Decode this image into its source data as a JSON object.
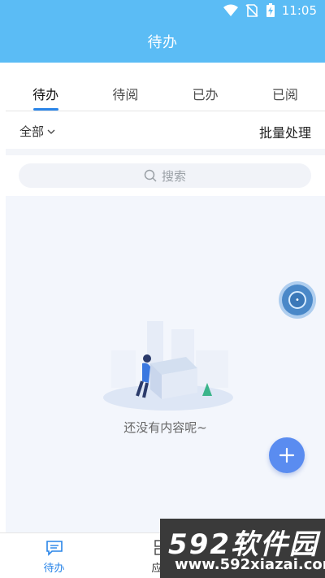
{
  "status": {
    "time": "11:05"
  },
  "header": {
    "title": "待办"
  },
  "tabs": [
    {
      "label": "待办",
      "active": true
    },
    {
      "label": "待阅",
      "active": false
    },
    {
      "label": "已办",
      "active": false
    },
    {
      "label": "已阅",
      "active": false
    }
  ],
  "filter": {
    "selected": "全部",
    "batch_label": "批量处理"
  },
  "search": {
    "placeholder": "搜索"
  },
  "empty_state": {
    "text": "还没有内容呢~"
  },
  "bottom_nav": [
    {
      "label": "待办",
      "icon": "message-icon",
      "active": true
    },
    {
      "label": "应用",
      "icon": "apps-grid-icon",
      "active": false
    },
    {
      "label": "",
      "icon": "profile-icon",
      "active": false
    }
  ],
  "watermark": {
    "brand": "592软件园",
    "url": "www.592xiazai.com"
  },
  "colors": {
    "header": "#5bbcf5",
    "accent": "#2a85e8",
    "fab": "#5a8cf0"
  }
}
